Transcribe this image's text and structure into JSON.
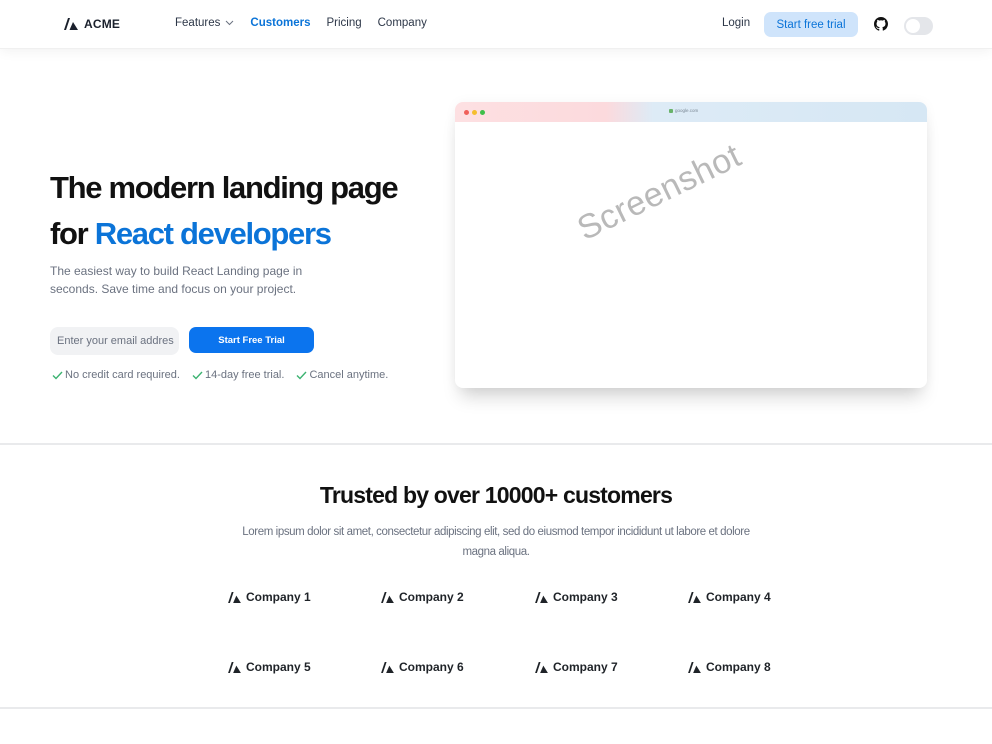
{
  "header": {
    "logo_text": "ACME",
    "nav": [
      {
        "label": "Features",
        "has_dropdown": true,
        "active": false
      },
      {
        "label": "Customers",
        "active": true
      },
      {
        "label": "Pricing",
        "active": false
      },
      {
        "label": "Company",
        "active": false
      }
    ],
    "login_label": "Login",
    "cta_label": "Start free trial",
    "github_icon": "github-icon",
    "theme_toggle": "off"
  },
  "hero": {
    "title_line1": "The modern landing page",
    "title_prefix": "for ",
    "title_accent": "React developers",
    "subtitle": "The easiest way to build React Landing page in seconds. Save time and focus on your project.",
    "email_placeholder": "Enter your email addres",
    "cta_label": "Start Free Trial",
    "features": [
      "No credit card required.",
      "14-day free trial.",
      "Cancel anytime."
    ],
    "mock_browser": {
      "url": "google.com",
      "watermark": "Screenshot"
    }
  },
  "trusted": {
    "title": "Trusted by over 10000+ customers",
    "subtitle": "Lorem ipsum dolor sit amet, consectetur adipiscing elit, sed do eiusmod tempor incididunt ut labore et dolore magna aliqua.",
    "companies": [
      "Company 1",
      "Company 2",
      "Company 3",
      "Company 4",
      "Company 5",
      "Company 6",
      "Company 7",
      "Company 8"
    ]
  },
  "colors": {
    "accent": "#0b74d8",
    "cta_bg": "#0b74ee",
    "cta_light_bg": "#cfe4fb",
    "check": "#3cb371"
  }
}
